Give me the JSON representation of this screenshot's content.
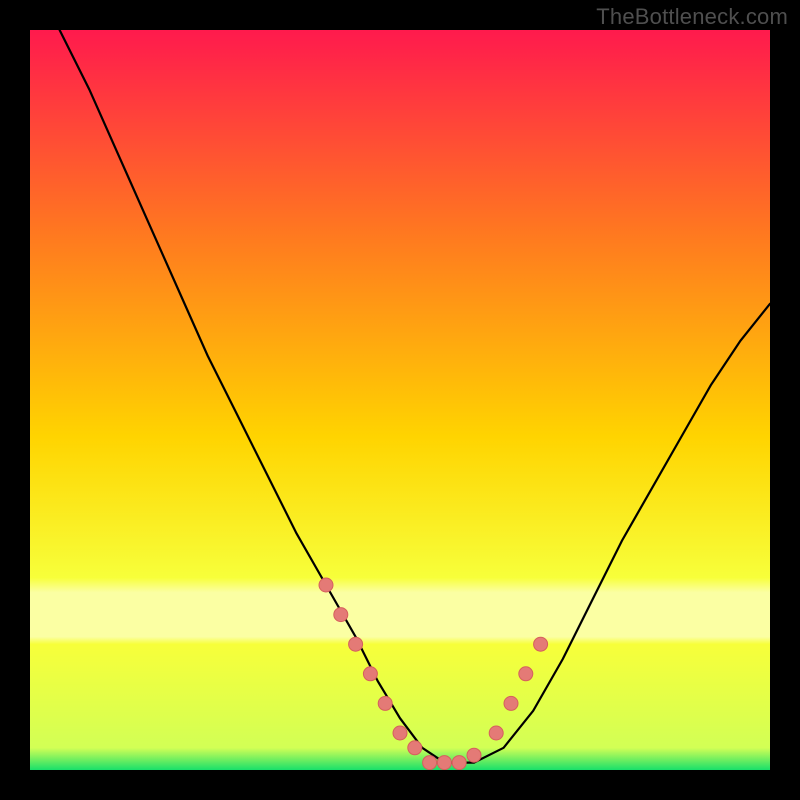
{
  "watermark": "TheBottleneck.com",
  "colors": {
    "frame": "#000000",
    "curve": "#000000",
    "marker_fill": "#e47a76",
    "marker_stroke": "#d65f5d",
    "gradient_top": "#ff1a4d",
    "gradient_mid1": "#ff7a1f",
    "gradient_mid2": "#ffd400",
    "gradient_mid3": "#f7ff3a",
    "gradient_band": "#fbffa3",
    "gradient_bottom": "#18e06a"
  },
  "chart_data": {
    "type": "line",
    "title": "",
    "xlabel": "",
    "ylabel": "",
    "xlim": [
      0,
      100
    ],
    "ylim": [
      0,
      100
    ],
    "grid": false,
    "legend": false,
    "series": [
      {
        "name": "bottleneck-curve",
        "x": [
          4,
          8,
          12,
          16,
          20,
          24,
          28,
          32,
          36,
          40,
          44,
          47,
          50,
          53,
          56,
          60,
          64,
          68,
          72,
          76,
          80,
          84,
          88,
          92,
          96,
          100
        ],
        "y": [
          100,
          92,
          83,
          74,
          65,
          56,
          48,
          40,
          32,
          25,
          18,
          12,
          7,
          3,
          1,
          1,
          3,
          8,
          15,
          23,
          31,
          38,
          45,
          52,
          58,
          63
        ]
      }
    ],
    "markers": {
      "name": "highlighted-points",
      "x": [
        40,
        42,
        44,
        46,
        48,
        50,
        52,
        54,
        56,
        58,
        60,
        63,
        65,
        67,
        69
      ],
      "y": [
        25,
        21,
        17,
        13,
        9,
        5,
        3,
        1,
        1,
        1,
        2,
        5,
        9,
        13,
        17
      ]
    }
  }
}
